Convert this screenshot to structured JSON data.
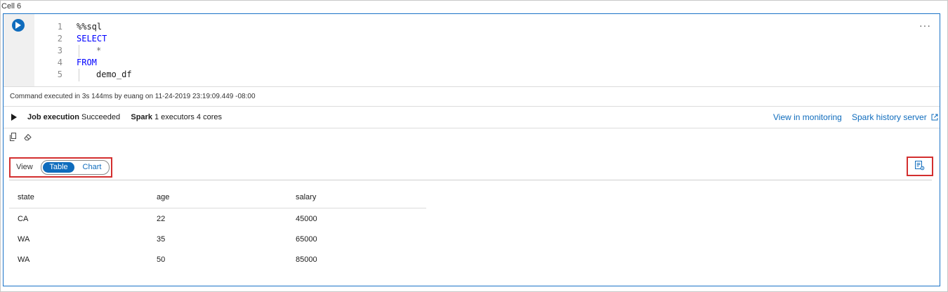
{
  "cell": {
    "title": "Cell 6",
    "more_label": "···"
  },
  "code": {
    "lines": [
      {
        "num": "1",
        "text": "%%sql"
      },
      {
        "num": "2",
        "text": "SELECT"
      },
      {
        "num": "3",
        "text": "*"
      },
      {
        "num": "4",
        "text": "FROM"
      },
      {
        "num": "5",
        "text": "demo_df"
      }
    ]
  },
  "execution": {
    "info": "Command executed in 3s 144ms by euang on 11-24-2019 23:19:09.449 -08:00",
    "job_label": "Job execution",
    "job_status": "Succeeded",
    "spark_label": "Spark",
    "spark_detail": "1 executors 4 cores",
    "monitoring_link": "View in monitoring",
    "history_link": "Spark history server"
  },
  "view": {
    "label": "View",
    "options": [
      "Table",
      "Chart"
    ],
    "selected": "Table"
  },
  "table": {
    "columns": [
      "state",
      "age",
      "salary"
    ],
    "rows": [
      [
        "CA",
        "22",
        "45000"
      ],
      [
        "WA",
        "35",
        "65000"
      ],
      [
        "WA",
        "50",
        "85000"
      ]
    ]
  },
  "colors": {
    "accent": "#0f6cbd",
    "highlight_border": "#d32f2f",
    "keyword": "#0000ff"
  },
  "icons": [
    "play-icon",
    "more-icon",
    "expand-icon",
    "external-link-icon",
    "copy-icon",
    "eraser-icon",
    "result-settings-icon"
  ]
}
